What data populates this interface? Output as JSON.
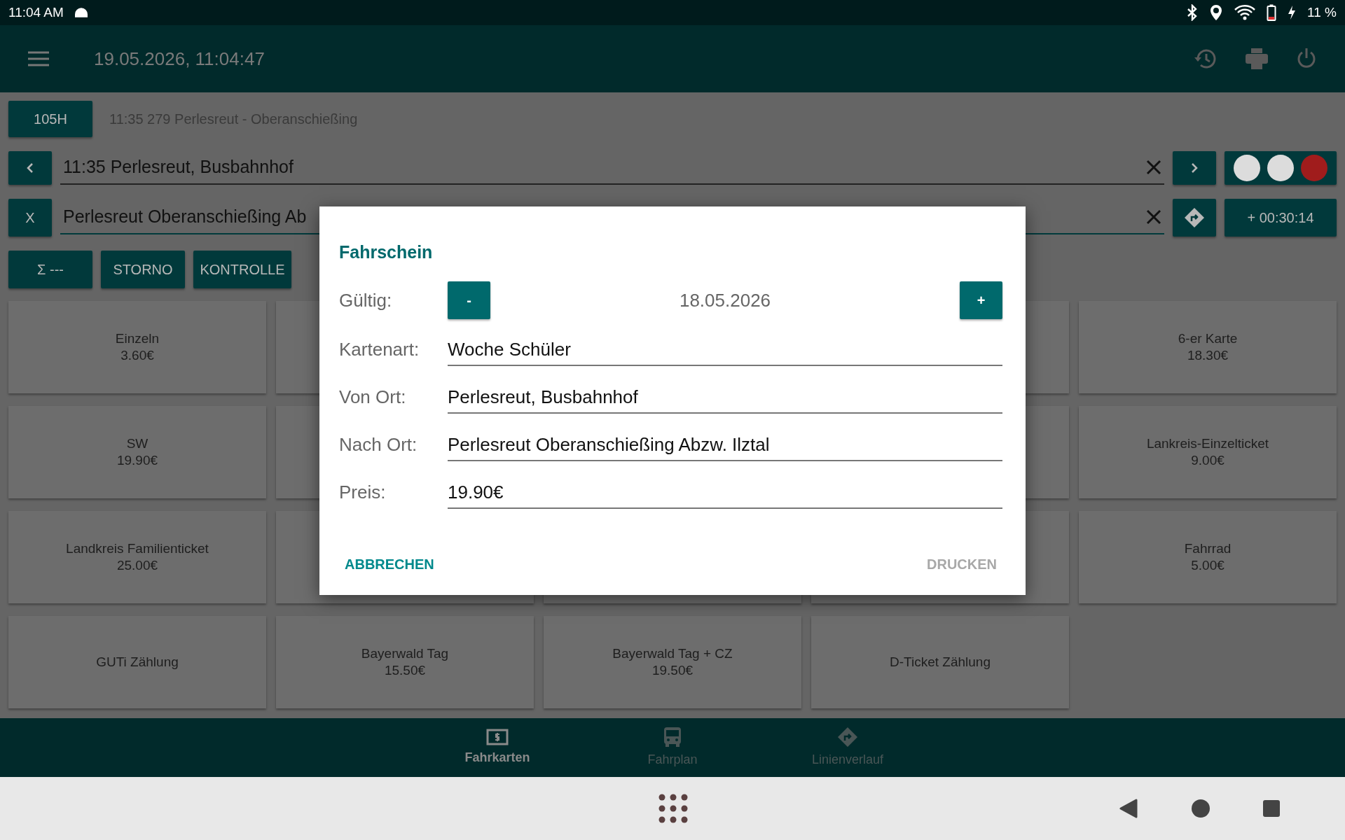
{
  "status_bar": {
    "time": "11:04 AM",
    "battery": "11 %"
  },
  "app_bar": {
    "datetime": "19.05.2026, 11:04:47"
  },
  "trip": {
    "line": "105H",
    "route": "11:35 279 Perlesreut - Oberanschießing"
  },
  "from_field": {
    "value": "11:35 Perlesreut, Busbahnhof"
  },
  "lights": [
    {
      "color": "#dcdcdc"
    },
    {
      "color": "#dcdcdc"
    },
    {
      "color": "#a01c1c"
    }
  ],
  "to_field": {
    "prefix": "X",
    "value": "Perlesreut Oberanschießing Ab",
    "delay": "+ 00:30:14"
  },
  "actions": [
    "Σ ---",
    "STORNO",
    "KONTROLLE"
  ],
  "tiles": [
    {
      "kind": "ticket",
      "name": "Einzeln",
      "price": "3.60€"
    },
    {
      "kind": "covered"
    },
    {
      "kind": "hidden"
    },
    {
      "kind": "covered"
    },
    {
      "kind": "ticket",
      "name": "6-er Karte",
      "price": "18.30€"
    },
    {
      "kind": "ticket",
      "name": "SW",
      "price": "19.90€"
    },
    {
      "kind": "covered"
    },
    {
      "kind": "hidden"
    },
    {
      "kind": "covered"
    },
    {
      "kind": "ticket",
      "name": "Lankreis-Einzelticket",
      "price": "9.00€"
    },
    {
      "kind": "ticket",
      "name": "Landkreis Familienticket",
      "price": "25.00€"
    },
    {
      "kind": "covered"
    },
    {
      "kind": "covered"
    },
    {
      "kind": "covered"
    },
    {
      "kind": "ticket",
      "name": "Fahrrad",
      "price": "5.00€"
    },
    {
      "kind": "ticket",
      "name": "GUTi Zählung"
    },
    {
      "kind": "ticket",
      "name": "Bayerwald Tag",
      "price": "15.50€"
    },
    {
      "kind": "ticket",
      "name": "Bayerwald Tag + CZ",
      "price": "19.50€"
    },
    {
      "kind": "ticket",
      "name": "D-Ticket Zählung"
    }
  ],
  "dialog": {
    "title": "Fahrschein",
    "valid": {
      "label": "Gültig:",
      "minus": "-",
      "date": "18.05.2026",
      "plus": "+"
    },
    "fields": [
      {
        "label": "Kartenart:",
        "value": "Woche Schüler"
      },
      {
        "label": "Von Ort:",
        "value": "Perlesreut, Busbahnhof"
      },
      {
        "label": "Nach Ort:",
        "value": "Perlesreut Oberanschießing Abzw. Ilztal"
      },
      {
        "label": "Preis:",
        "value": "19.90€"
      }
    ],
    "buttons": [
      {
        "label": "ABBRECHEN",
        "disabled": false
      },
      {
        "label": "DRUCKEN",
        "disabled": true
      }
    ]
  },
  "bottom_nav": [
    {
      "label": "Fahrkarten",
      "kind": "ticket",
      "selected": true
    },
    {
      "label": "Fahrplan",
      "kind": "bus",
      "selected": false
    },
    {
      "label": "Linienverlauf",
      "kind": "route",
      "selected": false
    }
  ]
}
